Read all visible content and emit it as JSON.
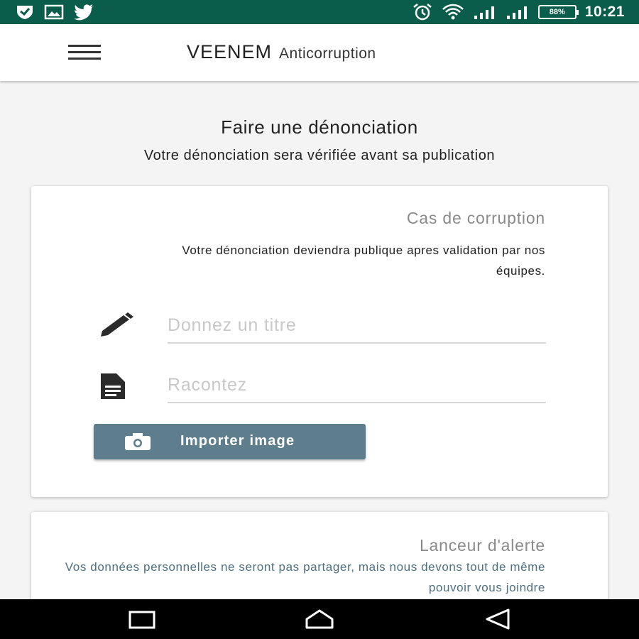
{
  "status_bar": {
    "time": "10:21",
    "battery_percent": "88%",
    "left_icons": [
      "shield-check-icon",
      "image-icon",
      "twitter-icon"
    ],
    "right_icons": [
      "alarm-icon",
      "wifi-icon",
      "signal-icon",
      "signal-icon",
      "battery-icon"
    ]
  },
  "app_bar": {
    "brand": "VEENEM",
    "subtitle": "Anticorruption",
    "menu_icon": "hamburger-menu-icon"
  },
  "header": {
    "title": "Faire une dénonciation",
    "subtitle": "Votre dénonciation sera vérifiée avant sa publication"
  },
  "corruption_card": {
    "title": "Cas de corruption",
    "description": "Votre dénonciation deviendra publique apres validation par nos équipes.",
    "title_field": {
      "placeholder": "Donnez un titre",
      "value": "",
      "icon": "pencil-icon"
    },
    "story_field": {
      "placeholder": "Racontez",
      "value": "",
      "icon": "document-icon"
    },
    "import_button": {
      "label": "Importer image",
      "icon": "camera-icon"
    }
  },
  "whistleblower_card": {
    "title": "Lanceur d'alerte",
    "description": "Vos données personnelles ne seront pas partager, mais nous devons tout de même pouvoir vous joindre"
  },
  "colors": {
    "status_bar": "#0b5d4b",
    "button": "#5e7d8d",
    "accent_text": "#4d6f80",
    "card_title": "#8a8a8a"
  },
  "nav_bar": {
    "buttons": [
      "recent-apps-icon",
      "home-icon",
      "back-icon"
    ]
  }
}
